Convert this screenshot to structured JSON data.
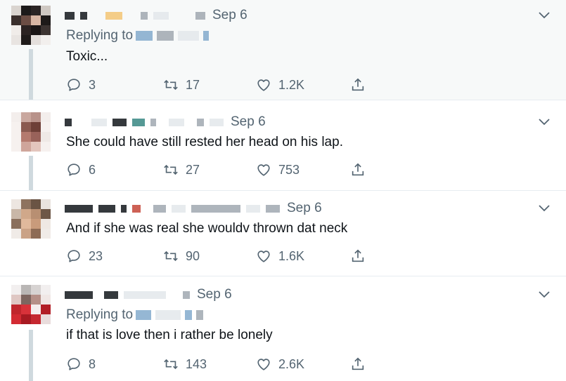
{
  "tweets": [
    {
      "date": "Sep 6",
      "replying_label": "Replying to",
      "text": "Toxic...",
      "replies": "3",
      "retweets": "17",
      "likes": "1.2K"
    },
    {
      "date": "Sep 6",
      "text": "She could have still rested her head on his lap.",
      "replies": "6",
      "retweets": "27",
      "likes": "753"
    },
    {
      "date": "Sep 6",
      "text": "And if she was real she wouldv thrown dat neck",
      "replies": "23",
      "retweets": "90",
      "likes": "1.6K"
    },
    {
      "date": "Sep 6",
      "replying_label": "Replying to",
      "text": "if that is love then i rather be lonely",
      "replies": "8",
      "retweets": "143",
      "likes": "2.6K"
    }
  ],
  "icons": {
    "reply": "reply-icon",
    "retweet": "retweet-icon",
    "like": "heart-icon",
    "share": "share-icon",
    "more": "chevron-down-icon"
  },
  "colors": {
    "muted_text": "#536471",
    "body_text": "#0f1419",
    "divider": "#e6ecf0",
    "thread_line": "#cfd9de",
    "shaded_bg": "#f7f9f9"
  }
}
